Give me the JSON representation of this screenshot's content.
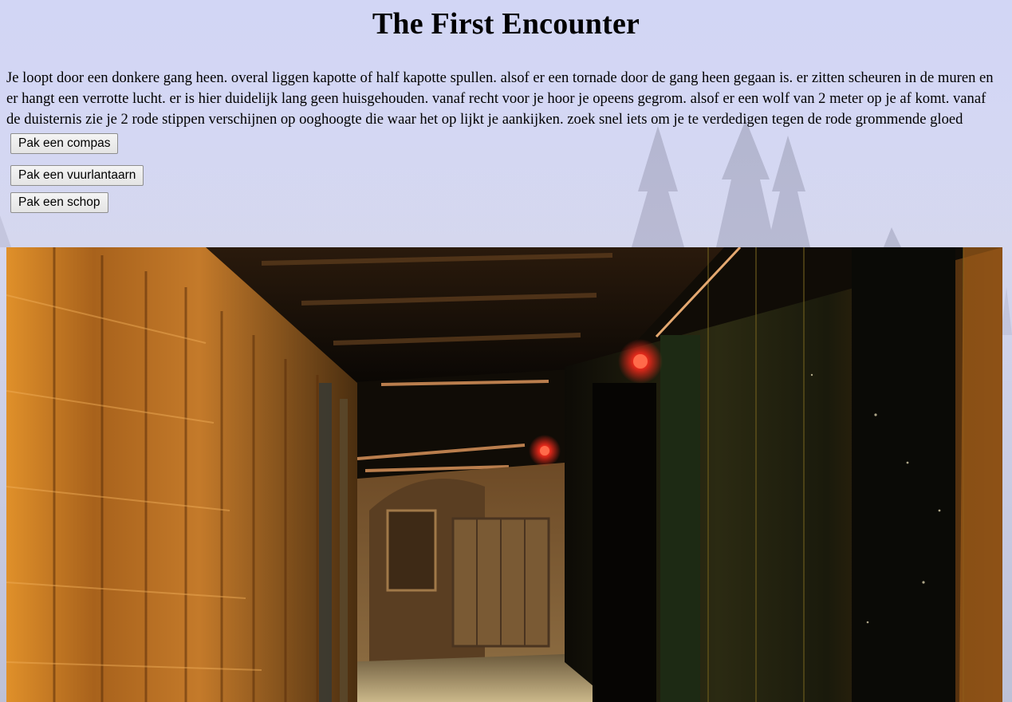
{
  "page": {
    "title": "The First Encounter",
    "story": "Je loopt door een donkere gang heen. overal liggen kapotte of half kapotte spullen. alsof er een tornade door de gang heen gegaan is. er zitten scheuren in de muren en er hangt een verrotte lucht. er is hier duidelijk lang geen huisgehouden. vanaf recht voor je hoor je opeens gegrom. alsof er een wolf van 2 meter op je af komt. vanaf de duisternis zie je 2 rode stippen verschijnen op ooghoogte die waar het op lijkt je aankijken. zoek snel iets om je te verdedigen tegen de rode grommende gloed"
  },
  "choices": {
    "compass_label": "Pak een compas",
    "lantern_label": "Pak een vuurlantaarn",
    "shovel_label": "Pak een schop"
  },
  "scene_image": {
    "subject": "dark alley corridor with red lamps"
  },
  "colors": {
    "background": "#d2d6f5",
    "lamp_red": "#e0281a",
    "wall_orange": "#c8741e"
  }
}
